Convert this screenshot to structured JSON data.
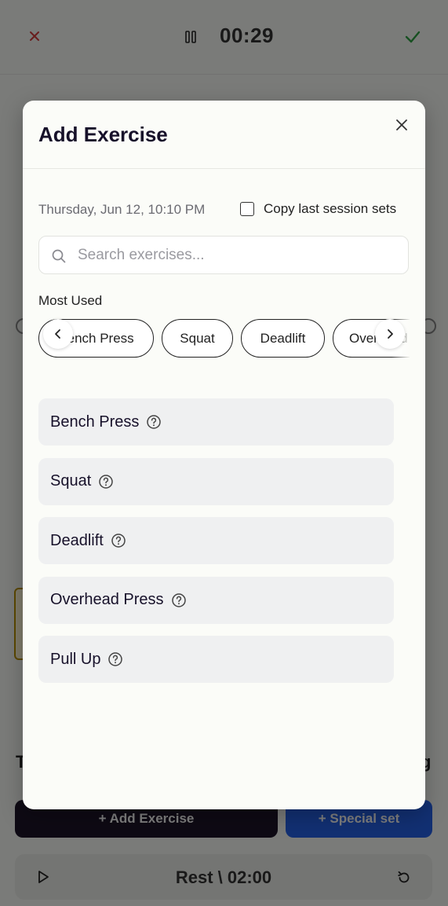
{
  "app": {
    "timer": "00:29",
    "add_exercise_button": "+ Add Exercise",
    "special_set_button": "+ Special set",
    "rest_label": "Rest \\ 02:00",
    "bg_letter_left": "T",
    "bg_letter_right": "g"
  },
  "modal": {
    "title": "Add Exercise",
    "date": "Thursday, Jun 12, 10:10 PM",
    "copy_label": "Copy last session sets",
    "search_placeholder": "Search exercises...",
    "search_value": "",
    "section_label": "Most Used",
    "chips": [
      "Bench Press",
      "Squat",
      "Deadlift",
      "Overhead Press"
    ],
    "exercises": [
      "Bench Press",
      "Squat",
      "Deadlift",
      "Overhead Press",
      "Pull Up"
    ]
  },
  "icons": {
    "close": "close-icon",
    "check": "check-icon",
    "pause": "pause-icon",
    "search": "search-icon",
    "help": "question-circle-icon",
    "prev": "chevron-left-icon",
    "next": "chevron-right-icon",
    "play": "play-icon",
    "reset": "reset-icon"
  },
  "colors": {
    "primary_dark": "#1c1428",
    "accent_blue": "#2460e6",
    "close_red": "#d33b3b",
    "check_green": "#2ea043"
  }
}
